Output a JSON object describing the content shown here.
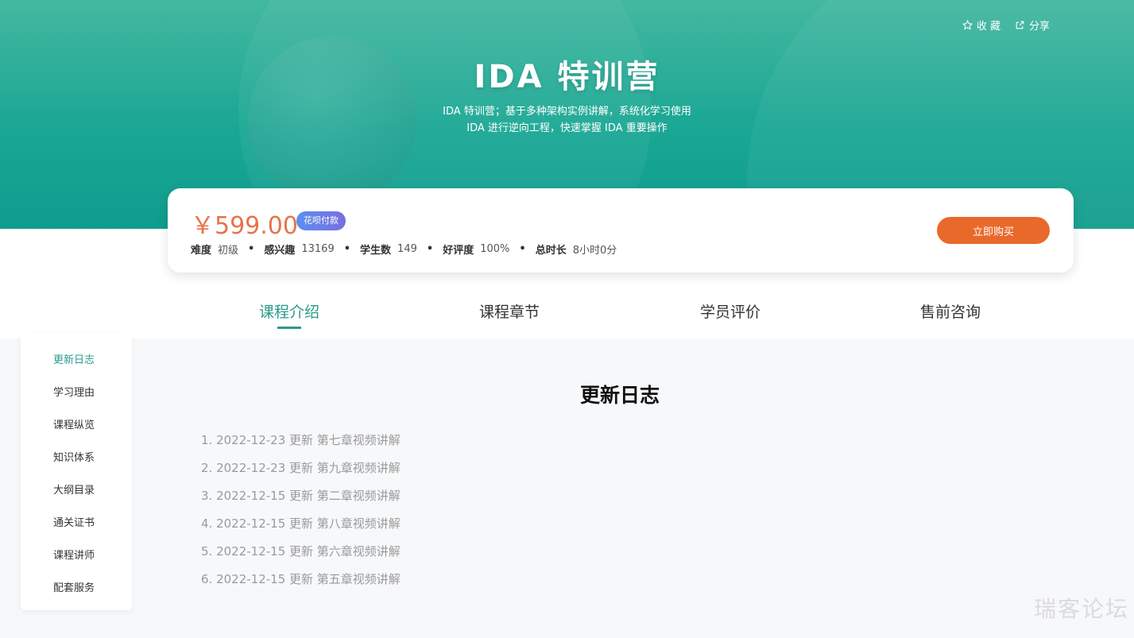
{
  "hero": {
    "title": "IDA 特训营",
    "subtitle_line1": "IDA 特训营；基于多种架构实例讲解，系统化学习使用",
    "subtitle_line2": "IDA 进行逆向工程，快速掌握 IDA 重要操作",
    "favorite_label": "收 藏",
    "share_label": "分享"
  },
  "course": {
    "price": "￥599.00",
    "payment_tag": "花呗付款",
    "stats": [
      {
        "label": "难度",
        "value": "初级"
      },
      {
        "label": "感兴趣",
        "value": "13169"
      },
      {
        "label": "学生数",
        "value": "149"
      },
      {
        "label": "好评度",
        "value": "100%"
      },
      {
        "label": "总时长",
        "value": "8小时0分"
      }
    ],
    "buy_label": "立即购买"
  },
  "tabs": [
    {
      "label": "课程介绍",
      "active": true
    },
    {
      "label": "课程章节",
      "active": false
    },
    {
      "label": "学员评价",
      "active": false
    },
    {
      "label": "售前咨询",
      "active": false
    }
  ],
  "sidebar": {
    "items": [
      {
        "label": "更新日志",
        "active": true
      },
      {
        "label": "学习理由",
        "active": false
      },
      {
        "label": "课程纵览",
        "active": false
      },
      {
        "label": "知识体系",
        "active": false
      },
      {
        "label": "大纲目录",
        "active": false
      },
      {
        "label": "通关证书",
        "active": false
      },
      {
        "label": "课程讲师",
        "active": false
      },
      {
        "label": "配套服务",
        "active": false
      }
    ]
  },
  "changelog": {
    "title": "更新日志",
    "entries": [
      "1. 2022-12-23 更新 第七章视频讲解",
      "2. 2022-12-23 更新 第九章视频讲解",
      "3. 2022-12-15 更新 第二章视频讲解",
      "4. 2022-12-15 更新 第八章视频讲解",
      "5. 2022-12-15 更新 第六章视频讲解",
      "6. 2022-12-15 更新 第五章视频讲解"
    ]
  },
  "watermark": "瑞客论坛",
  "colors": {
    "accent": "#2b9b8c",
    "price": "#e8734a",
    "buy_button": "#e9692a",
    "hero_top": "#43b8a0",
    "hero_bottom": "#109d8e"
  }
}
